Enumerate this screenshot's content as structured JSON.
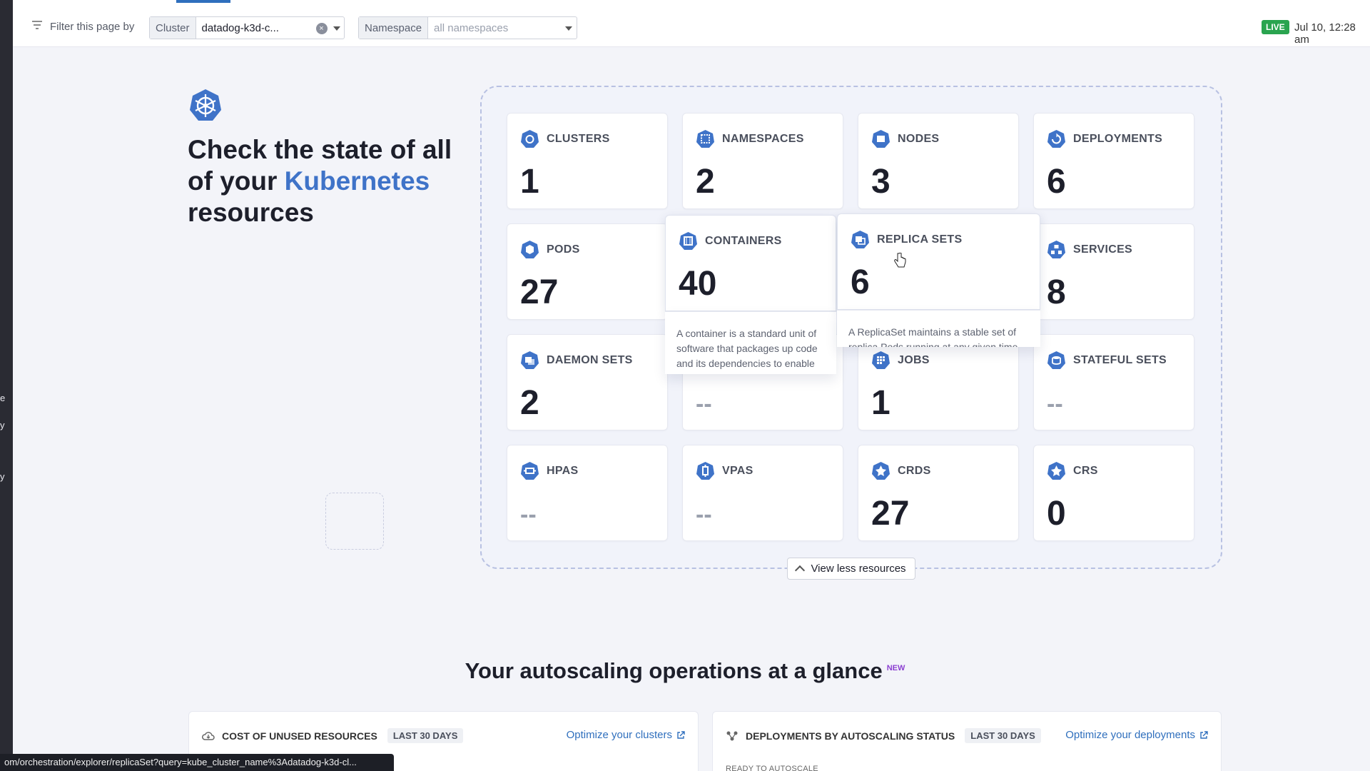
{
  "filter_bar": {
    "label": "Filter this page by",
    "cluster": {
      "tag": "Cluster",
      "value": "datadog-k3d-c..."
    },
    "namespace": {
      "tag": "Namespace",
      "placeholder": "all namespaces"
    },
    "live_label": "LIVE",
    "timestamp": "Jul 10, 12:28 am"
  },
  "hero": {
    "title_part1": "Check the state of all of your",
    "title_accent": "Kubernetes",
    "title_part2": "resources"
  },
  "resources": {
    "clusters": {
      "label": "CLUSTERS",
      "count": "1",
      "icon": "clusters-icon"
    },
    "namespaces": {
      "label": "NAMESPACES",
      "count": "2",
      "icon": "namespaces-icon"
    },
    "nodes": {
      "label": "NODES",
      "count": "3",
      "icon": "nodes-icon"
    },
    "deployments": {
      "label": "DEPLOYMENTS",
      "count": "6",
      "icon": "deployments-icon"
    },
    "pods": {
      "label": "PODS",
      "count": "27",
      "icon": "pods-icon"
    },
    "containers": {
      "label": "CONTAINERS",
      "count": "40",
      "icon": "containers-icon",
      "description": "A container is a standard unit of software that packages up code and its dependencies to enable apps to run seamlessly across environments"
    },
    "replica_sets": {
      "label": "REPLICA SETS",
      "count": "6",
      "icon": "replica-sets-icon",
      "description": "A ReplicaSet maintains a stable set of replica Pods running at any given time"
    },
    "services": {
      "label": "SERVICES",
      "count": "8",
      "icon": "services-icon"
    },
    "daemon_sets": {
      "label": "DAEMON SETS",
      "count": "2",
      "icon": "daemon-sets-icon"
    },
    "hidden_card": {
      "count": "--"
    },
    "jobs": {
      "label": "JOBS",
      "count": "1",
      "icon": "jobs-icon"
    },
    "stateful_sets": {
      "label": "STATEFUL SETS",
      "count": "--",
      "icon": "stateful-sets-icon"
    },
    "hpas": {
      "label": "HPAS",
      "count": "--",
      "icon": "hpas-icon"
    },
    "vpas": {
      "label": "VPAS",
      "count": "--",
      "icon": "vpas-icon"
    },
    "crds": {
      "label": "CRDS",
      "count": "27",
      "icon": "crds-icon"
    },
    "crs": {
      "label": "CRS",
      "count": "0",
      "icon": "crs-icon"
    }
  },
  "view_less_label": "View less resources",
  "autoscaling": {
    "title": "Your autoscaling operations at a glance",
    "new_badge": "NEW",
    "cost_card": {
      "title": "COST OF UNUSED RESOURCES",
      "range": "LAST 30 DAYS",
      "link": "Optimize your clusters"
    },
    "deploy_card": {
      "title": "DEPLOYMENTS BY AUTOSCALING STATUS",
      "range": "LAST 30 DAYS",
      "link": "Optimize your deployments",
      "sublabel": "READY TO AUTOSCALE"
    }
  },
  "status_url": "om/orchestration/explorer/replicaSet?query=kube_cluster_name%3Adatadog-k3d-cl...",
  "colors": {
    "accent": "#3f73c8",
    "live": "#2aa44f",
    "link": "#2f6fbd",
    "new": "#8b3fd1"
  }
}
